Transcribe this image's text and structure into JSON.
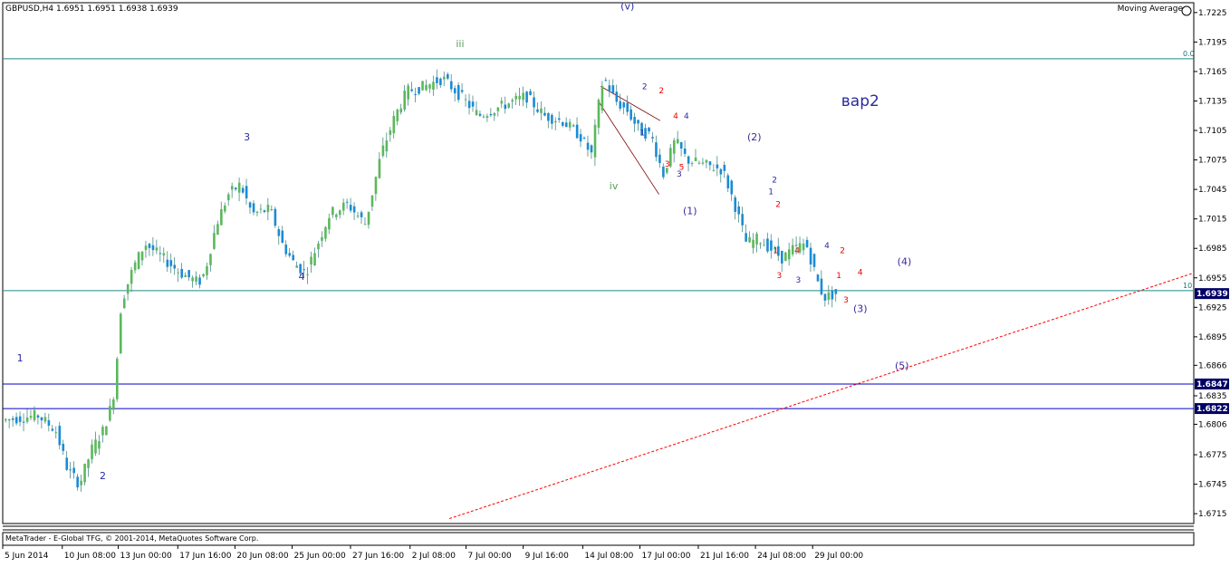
{
  "window": {
    "title": "GBPUSD,H4  1.6951 1.6951 1.6938 1.6939",
    "indicator": "Moving Average",
    "copyright": "MetaTrader - E-Global TFG, © 2001-2014, MetaQuotes Software Corp."
  },
  "colors": {
    "up": "#5cb85c",
    "down": "#1a8bd6",
    "wick": "#4a8a8a",
    "hline": "#1f8a8a",
    "blue_line": "#0000cc",
    "trend": "#ff0000",
    "wave_blue": "#2a2aa0",
    "wave_red": "#ee0000",
    "wave_green": "#5a9a5a",
    "price_bg": "#000066"
  },
  "chart_data": {
    "type": "candlestick",
    "symbol": "GBPUSD",
    "timeframe": "H4",
    "ylim": [
      1.6705,
      1.7235
    ],
    "y_ticks": [
      "1.7225",
      "1.7195",
      "1.7165",
      "1.7135",
      "1.7105",
      "1.7075",
      "1.7045",
      "1.7015",
      "1.6985",
      "1.6955",
      "1.6925",
      "1.6895",
      "1.6866",
      "1.6835",
      "1.6806",
      "1.6775",
      "1.6745",
      "1.6715"
    ],
    "x_ticks": [
      "5 Jun 2014",
      "10 Jun 08:00",
      "13 Jun 00:00",
      "17 Jun 16:00",
      "20 Jun 08:00",
      "25 Jun 00:00",
      "27 Jun 16:00",
      "2 Jul 08:00",
      "7 Jul 00:00",
      "9 Jul 16:00",
      "14 Jul 08:00",
      "17 Jul 00:00",
      "21 Jul 16:00",
      "24 Jul 08:00",
      "29 Jul 00:00"
    ],
    "price_marks": [
      {
        "label": "1.6939",
        "value": 1.6939
      },
      {
        "label": "1.6847",
        "value": 1.6847
      },
      {
        "label": "1.6822",
        "value": 1.6822
      }
    ],
    "hlines": [
      {
        "value": 1.7178,
        "label": "0.0",
        "style": "teal"
      },
      {
        "value": 1.6942,
        "label": "10",
        "style": "teal"
      },
      {
        "value": 1.6847,
        "label": "",
        "style": "blue"
      },
      {
        "value": 1.6822,
        "label": "",
        "style": "blue"
      }
    ],
    "trend_line": {
      "from": [
        0.375,
        1.671
      ],
      "to": [
        1.0,
        1.696
      ]
    },
    "fib_lines": [
      {
        "from": [
          0.502,
          1.715
        ],
        "to": [
          0.552,
          1.7115
        ]
      },
      {
        "from": [
          0.5,
          1.7135
        ],
        "to": [
          0.551,
          1.704
        ]
      }
    ],
    "path": [
      [
        0.0,
        1.681
      ],
      [
        0.03,
        1.6815
      ],
      [
        0.045,
        1.68
      ],
      [
        0.055,
        1.676
      ],
      [
        0.065,
        1.6745
      ],
      [
        0.075,
        1.678
      ],
      [
        0.085,
        1.68
      ],
      [
        0.093,
        1.683
      ],
      [
        0.097,
        1.688
      ],
      [
        0.1,
        1.693
      ],
      [
        0.11,
        1.6965
      ],
      [
        0.12,
        1.699
      ],
      [
        0.135,
        1.6975
      ],
      [
        0.15,
        1.696
      ],
      [
        0.165,
        1.695
      ],
      [
        0.17,
        1.696
      ],
      [
        0.18,
        1.701
      ],
      [
        0.19,
        1.704
      ],
      [
        0.2,
        1.705
      ],
      [
        0.21,
        1.702
      ],
      [
        0.225,
        1.7025
      ],
      [
        0.235,
        1.699
      ],
      [
        0.245,
        1.697
      ],
      [
        0.255,
        1.696
      ],
      [
        0.265,
        1.699
      ],
      [
        0.275,
        1.702
      ],
      [
        0.29,
        1.703
      ],
      [
        0.305,
        1.701
      ],
      [
        0.318,
        1.708
      ],
      [
        0.33,
        1.712
      ],
      [
        0.34,
        1.7145
      ],
      [
        0.355,
        1.715
      ],
      [
        0.37,
        1.7158
      ],
      [
        0.385,
        1.714
      ],
      [
        0.4,
        1.712
      ],
      [
        0.42,
        1.713
      ],
      [
        0.44,
        1.714
      ],
      [
        0.455,
        1.712
      ],
      [
        0.47,
        1.7115
      ],
      [
        0.485,
        1.71
      ],
      [
        0.495,
        1.708
      ],
      [
        0.5,
        1.7125
      ],
      [
        0.505,
        1.716
      ],
      [
        0.515,
        1.7135
      ],
      [
        0.525,
        1.7125
      ],
      [
        0.535,
        1.7105
      ],
      [
        0.545,
        1.71
      ],
      [
        0.555,
        1.706
      ],
      [
        0.565,
        1.7095
      ],
      [
        0.575,
        1.7075
      ],
      [
        0.59,
        1.707
      ],
      [
        0.605,
        1.7065
      ],
      [
        0.615,
        1.703
      ],
      [
        0.625,
        1.699
      ],
      [
        0.635,
        1.6995
      ],
      [
        0.645,
        1.6985
      ],
      [
        0.655,
        1.6975
      ],
      [
        0.665,
        1.6985
      ],
      [
        0.675,
        1.699
      ],
      [
        0.685,
        1.695
      ],
      [
        0.69,
        1.6935
      ],
      [
        0.7,
        1.6939
      ]
    ],
    "wave_labels": [
      {
        "text": "(v)",
        "x": 0.5245,
        "y": 1.7228,
        "color": "blue"
      },
      {
        "text": "iii",
        "x": 0.384,
        "y": 1.719,
        "color": "green"
      },
      {
        "text": "iv",
        "x": 0.513,
        "y": 1.7045,
        "color": "green"
      },
      {
        "text": "1",
        "x": 0.0145,
        "y": 1.687,
        "color": "blue"
      },
      {
        "text": "2",
        "x": 0.084,
        "y": 1.675,
        "color": "blue"
      },
      {
        "text": "3",
        "x": 0.205,
        "y": 1.7095,
        "color": "blue"
      },
      {
        "text": "4",
        "x": 0.251,
        "y": 1.6953,
        "color": "blue"
      },
      {
        "text": "вар2",
        "x": 0.72,
        "y": 1.713,
        "color": "blue",
        "size": 17
      },
      {
        "text": "(1)",
        "x": 0.577,
        "y": 1.702,
        "color": "purple"
      },
      {
        "text": "(2)",
        "x": 0.631,
        "y": 1.7095,
        "color": "purple"
      },
      {
        "text": "(3)",
        "x": 0.72,
        "y": 1.692,
        "color": "purple"
      },
      {
        "text": "(4)",
        "x": 0.757,
        "y": 1.6968,
        "color": "purple"
      },
      {
        "text": "(5)",
        "x": 0.755,
        "y": 1.6862,
        "color": "purple"
      },
      {
        "text": "2",
        "x": 0.539,
        "y": 1.7147,
        "color": "blue",
        "size": 9
      },
      {
        "text": "2",
        "x": 0.553,
        "y": 1.7143,
        "color": "red",
        "size": 9
      },
      {
        "text": "4",
        "x": 0.565,
        "y": 1.7117,
        "color": "red",
        "size": 9
      },
      {
        "text": "4",
        "x": 0.574,
        "y": 1.7117,
        "color": "blue",
        "size": 9
      },
      {
        "text": "1",
        "x": 0.537,
        "y": 1.71,
        "color": "blue",
        "size": 9
      },
      {
        "text": "3",
        "x": 0.558,
        "y": 1.7068,
        "color": "red",
        "size": 9
      },
      {
        "text": "5",
        "x": 0.57,
        "y": 1.7065,
        "color": "red",
        "size": 9
      },
      {
        "text": "3",
        "x": 0.568,
        "y": 1.7058,
        "color": "blue",
        "size": 9
      },
      {
        "text": "2",
        "x": 0.648,
        "y": 1.7052,
        "color": "blue",
        "size": 9
      },
      {
        "text": "1",
        "x": 0.645,
        "y": 1.704,
        "color": "blue",
        "size": 9
      },
      {
        "text": "2",
        "x": 0.651,
        "y": 1.7027,
        "color": "red",
        "size": 9
      },
      {
        "text": "1",
        "x": 0.649,
        "y": 1.698,
        "color": "red",
        "size": 9
      },
      {
        "text": "4",
        "x": 0.667,
        "y": 1.698,
        "color": "red",
        "size": 9
      },
      {
        "text": "3",
        "x": 0.652,
        "y": 1.6955,
        "color": "red",
        "size": 9
      },
      {
        "text": "3",
        "x": 0.668,
        "y": 1.695,
        "color": "blue",
        "size": 9
      },
      {
        "text": "4",
        "x": 0.692,
        "y": 1.6985,
        "color": "blue",
        "size": 9
      },
      {
        "text": "2",
        "x": 0.705,
        "y": 1.698,
        "color": "red",
        "size": 9
      },
      {
        "text": "1",
        "x": 0.702,
        "y": 1.6955,
        "color": "red",
        "size": 9
      },
      {
        "text": "4",
        "x": 0.72,
        "y": 1.6958,
        "color": "red",
        "size": 9
      },
      {
        "text": "3",
        "x": 0.708,
        "y": 1.693,
        "color": "red",
        "size": 9
      }
    ]
  }
}
